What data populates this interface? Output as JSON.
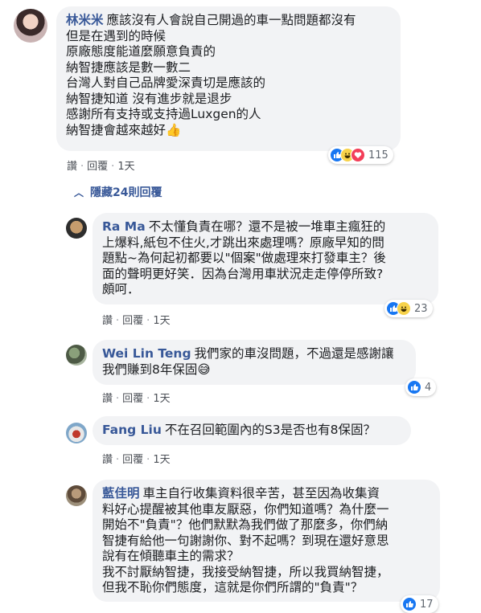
{
  "comments": [
    {
      "name": "林米米",
      "lines": [
        "應該沒有人會說自己開過的車一點問題都沒有",
        "但是在遇到的時候",
        "原廠態度能道麼願意負責的",
        "納智捷應該是數一數二",
        "台灣人對自己品牌愛深責切是應該的",
        "納智捷知道 沒有進步就是退步",
        "感謝所有支持或支持過Luxgen的人",
        "納智捷會越來越好👍"
      ],
      "actions": {
        "like": "讚",
        "reply": "回覆",
        "time": "1天"
      },
      "reactions": {
        "count": "115",
        "icons": [
          "like-icon",
          "haha-icon",
          "love-icon"
        ]
      }
    },
    {
      "name": "Ra Ma",
      "lines": [
        "不太懂負責在哪？還不是被一堆車主瘋狂的",
        "上爆料,紙包不住火,才跳出來處理嗎？原廠早知的問",
        "題點~為何起初都要以\"個案\"做處理來打發車主？後",
        "面的聲明更好笑．因為台灣用車狀況走走停停所致?",
        "頗呵．"
      ],
      "actions": {
        "like": "讚",
        "reply": "回覆",
        "time": "1天"
      },
      "reactions": {
        "count": "23",
        "icons": [
          "like-icon",
          "haha-icon"
        ]
      }
    },
    {
      "name": "Wei Lin Teng",
      "lines": [
        "我們家的車沒問題，不過還是感謝讓",
        "我們賺到8年保固😅"
      ],
      "actions": {
        "like": "讚",
        "reply": "回覆",
        "time": "1天"
      },
      "reactions": {
        "count": "4",
        "icons": [
          "like-icon"
        ]
      }
    },
    {
      "name": "Fang Liu",
      "lines": [
        "不在召回範圍內的S3是否也有8保固？"
      ],
      "actions": {
        "like": "讚",
        "reply": "回覆",
        "time": "1天"
      }
    },
    {
      "name": "藍佳明",
      "lines": [
        "車主自行收集資料很辛苦，甚至因為收集資",
        "料好心提醒被其他車友厭惡，你們知道嗎？為什麼一",
        "開始不\"負責\"？他們默默為我們做了那麼多，你們納",
        "智捷有給他一句謝謝你、對不起嗎？到現在還好意思",
        "說有在傾聽車主的需求？",
        "我不討厭納智捷，我接受納智捷，所以我買納智捷，",
        "但我不恥你們態度，這就是你們所謂的\"負責\"？"
      ],
      "actions": {
        "like": "讚",
        "reply": "回覆",
        "time": "1天"
      },
      "reactions": {
        "count": "17",
        "icons": [
          "like-icon"
        ]
      }
    }
  ],
  "hide_replies": "隱藏24則回覆",
  "colors": {
    "name": "#385898",
    "bubble": "#f2f3f5",
    "like": "#1877f2",
    "love": "#f33e58",
    "haha": "#f7d24a"
  }
}
